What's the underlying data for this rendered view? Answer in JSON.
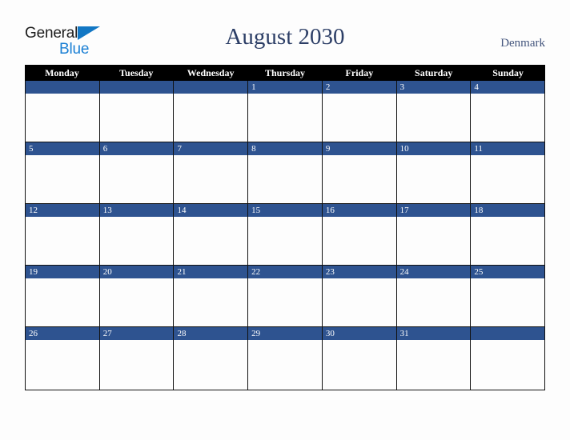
{
  "logo": {
    "word_top": "General",
    "word_bottom": "Blue",
    "triangle_color": "#1277c4",
    "bottom_color": "#1a7fd4"
  },
  "header": {
    "title": "August 2030",
    "country": "Denmark"
  },
  "colors": {
    "background": "#fdfdfd",
    "weekday_header_bg": "#000000",
    "weekday_header_text": "#ffffff",
    "day_bar": "#2e5390",
    "day_number": "#ffffff",
    "title_text": "#2c3e66",
    "grid_line": "#111111"
  },
  "calendar": {
    "month": "August",
    "year": "2030",
    "first_day_of_week": "Monday",
    "weekdays": [
      "Monday",
      "Tuesday",
      "Wednesday",
      "Thursday",
      "Friday",
      "Saturday",
      "Sunday"
    ],
    "weeks": [
      [
        "",
        "",
        "",
        "1",
        "2",
        "3",
        "4"
      ],
      [
        "5",
        "6",
        "7",
        "8",
        "9",
        "10",
        "11"
      ],
      [
        "12",
        "13",
        "14",
        "15",
        "16",
        "17",
        "18"
      ],
      [
        "19",
        "20",
        "21",
        "22",
        "23",
        "24",
        "25"
      ],
      [
        "26",
        "27",
        "28",
        "29",
        "30",
        "31",
        ""
      ]
    ]
  }
}
